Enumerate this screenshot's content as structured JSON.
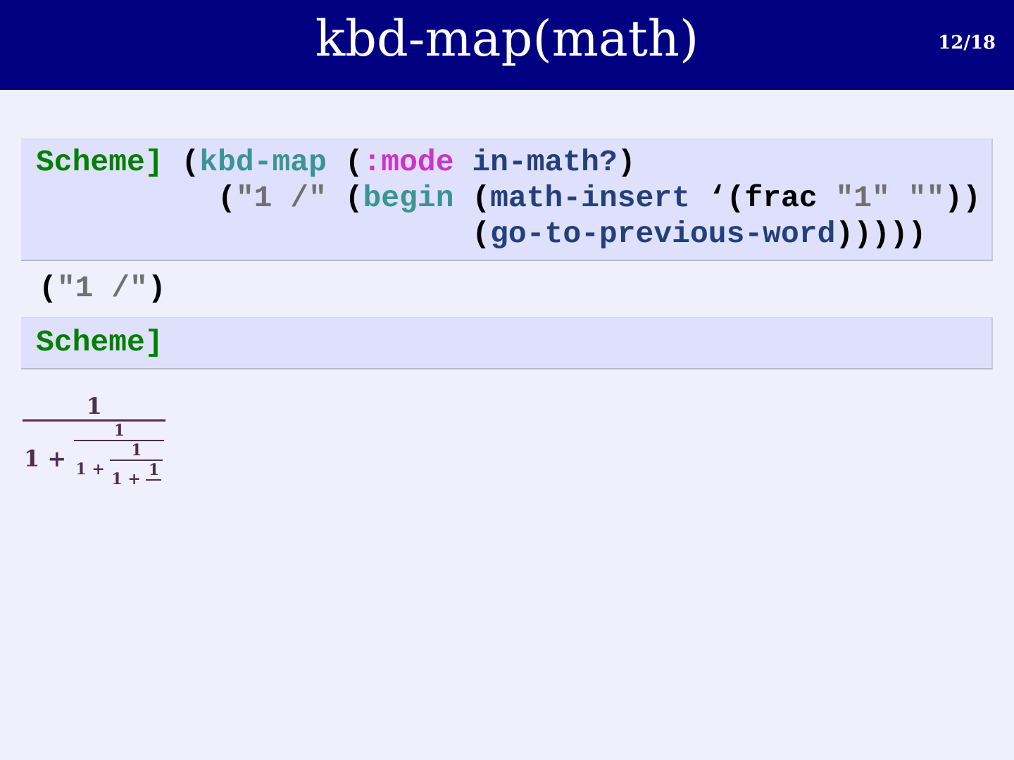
{
  "header": {
    "title": "kbd-map(math)",
    "page": "12/18"
  },
  "colors": {
    "header_bg": "#000080",
    "session_bg": "#dfe0fb",
    "prompt": "#008000",
    "math": "#4d2e4d"
  },
  "session": {
    "prompt": "Scheme]",
    "input_lines": [
      [
        {
          "t": "Scheme] ",
          "c": "prompt"
        },
        {
          "t": "(",
          "c": "black"
        },
        {
          "t": "kbd-map",
          "c": "teal"
        },
        {
          "t": " (",
          "c": "black"
        },
        {
          "t": ":mode",
          "c": "mag"
        },
        {
          "t": " in-math?",
          "c": "navy"
        },
        {
          "t": ")",
          "c": "black"
        }
      ],
      [
        {
          "t": "          (",
          "c": "black"
        },
        {
          "t": "\"1 /\"",
          "c": "gray"
        },
        {
          "t": " (",
          "c": "black"
        },
        {
          "t": "begin",
          "c": "teal"
        },
        {
          "t": " (",
          "c": "black"
        },
        {
          "t": "math-insert",
          "c": "navy"
        },
        {
          "t": " ‘(frac ",
          "c": "black"
        },
        {
          "t": "\"1\"",
          "c": "gray"
        },
        {
          "t": " ",
          "c": "black"
        },
        {
          "t": "\"\"",
          "c": "gray"
        },
        {
          "t": "))",
          "c": "black"
        }
      ],
      [
        {
          "t": "                        (",
          "c": "black"
        },
        {
          "t": "go-to-previous-word",
          "c": "navy"
        },
        {
          "t": ")))))",
          "c": "black"
        }
      ]
    ],
    "output": [
      {
        "t": "(",
        "c": "black"
      },
      {
        "t": "\"1 /\"",
        "c": "gray"
      },
      {
        "t": ")",
        "c": "black"
      }
    ]
  },
  "math": {
    "one": "1",
    "plus": "1 + "
  }
}
